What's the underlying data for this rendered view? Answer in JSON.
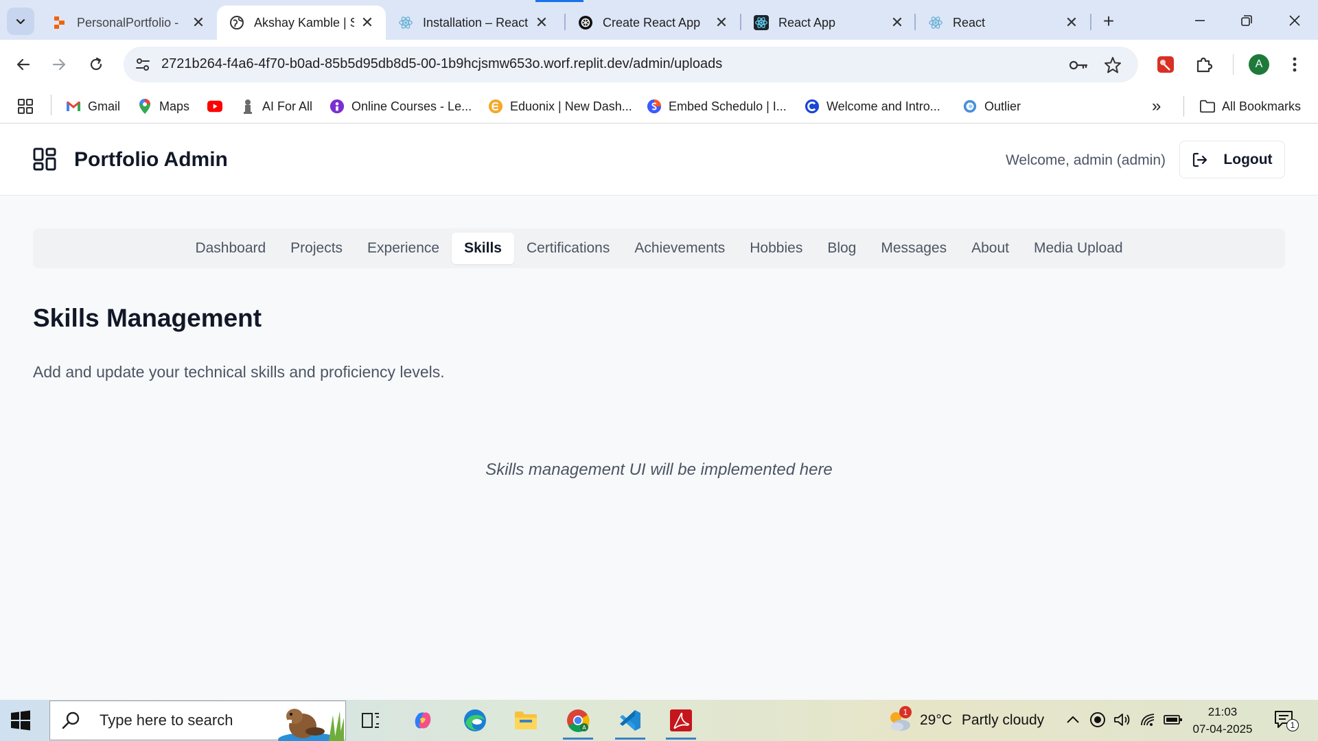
{
  "browser": {
    "tabs": [
      {
        "title": "PersonalPortfolio -",
        "icon": "replit-icon",
        "active": false
      },
      {
        "title": "Akshay Kamble | S",
        "icon": "globe-icon",
        "active": true
      },
      {
        "title": "Installation – React",
        "icon": "react-icon",
        "active": false
      },
      {
        "title": "Create React App",
        "icon": "openai-icon",
        "active": false
      },
      {
        "title": "React App",
        "icon": "react-icon",
        "active": false
      },
      {
        "title": "React",
        "icon": "react-icon",
        "active": false
      }
    ],
    "close_glyph": "✕",
    "newtab_glyph": "+",
    "url": "2721b264-f4a6-4f70-b0ad-85b5d95db8d5-00-1b9hcjsmw653o.worf.replit.dev/admin/uploads",
    "profile_initial": "A",
    "bookmarks": [
      {
        "label": "Gmail",
        "icon": "gmail-icon"
      },
      {
        "label": "Maps",
        "icon": "maps-icon"
      },
      {
        "label": "",
        "icon": "youtube-icon"
      },
      {
        "label": "AI For All",
        "icon": "emblem-icon"
      },
      {
        "label": "Online Courses - Le...",
        "icon": "courses-icon"
      },
      {
        "label": "Eduonix | New Dash...",
        "icon": "eduonix-icon"
      },
      {
        "label": "Embed Schedulo | I...",
        "icon": "schedulo-icon"
      },
      {
        "label": "Welcome and Intro...",
        "icon": "c-icon"
      },
      {
        "label": "Outlier",
        "icon": "outlier-icon"
      }
    ],
    "more_glyph": "»",
    "all_bookmarks": "All Bookmarks"
  },
  "app": {
    "title": "Portfolio Admin",
    "welcome": "Welcome, admin (admin)",
    "logout": "Logout",
    "nav": [
      {
        "label": "Dashboard",
        "active": false
      },
      {
        "label": "Projects",
        "active": false
      },
      {
        "label": "Experience",
        "active": false
      },
      {
        "label": "Skills",
        "active": true
      },
      {
        "label": "Certifications",
        "active": false
      },
      {
        "label": "Achievements",
        "active": false
      },
      {
        "label": "Hobbies",
        "active": false
      },
      {
        "label": "Blog",
        "active": false
      },
      {
        "label": "Messages",
        "active": false
      },
      {
        "label": "About",
        "active": false
      },
      {
        "label": "Media Upload",
        "active": false
      }
    ],
    "section_title": "Skills Management",
    "section_desc": "Add and update your technical skills and proficiency levels.",
    "placeholder": "Skills management UI will be implemented here"
  },
  "taskbar": {
    "search_placeholder": "Type here to search",
    "apps": [
      "task-view-icon",
      "copilot-icon",
      "edge-icon",
      "file-explorer-icon",
      "chrome-icon",
      "vscode-icon",
      "acrobat-icon"
    ],
    "weather_badge": "1",
    "temperature": "29°C",
    "weather": "Partly cloudy",
    "time": "21:03",
    "date": "07-04-2025",
    "notification_count": "1"
  },
  "colors": {
    "tabstrip": "#dde6f7",
    "accent": "#1a73e8",
    "text_primary": "#111827",
    "text_secondary": "#4b5563"
  }
}
